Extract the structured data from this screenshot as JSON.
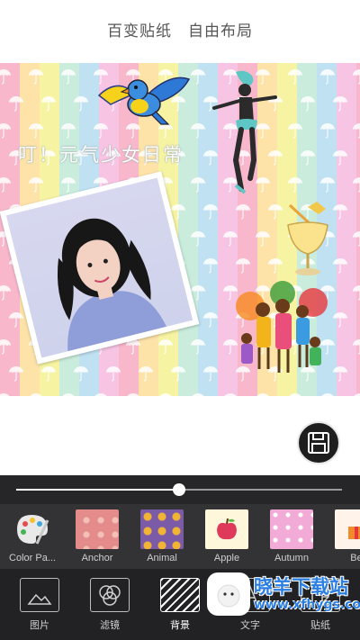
{
  "header": {
    "title": "百变贴纸　自由布局"
  },
  "canvas": {
    "caption": "叮！元气少女日常"
  },
  "slider": {
    "value": 0.5
  },
  "backgrounds": [
    {
      "label": "Color Pa...",
      "icon": "palette-icon",
      "color": "#333336"
    },
    {
      "label": "Anchor",
      "icon": "anchor-pattern",
      "color": "#e8888e"
    },
    {
      "label": "Animal",
      "icon": "animal-pattern",
      "color": "#7a5aa8"
    },
    {
      "label": "Apple",
      "icon": "apple-pattern",
      "color": "#fff7dc"
    },
    {
      "label": "Autumn",
      "icon": "autumn-pattern",
      "color": "#f3a9d6"
    },
    {
      "label": "Be",
      "icon": "pattern",
      "color": "#fff0e8"
    }
  ],
  "tabs": [
    {
      "label": "图片",
      "icon": "image-icon"
    },
    {
      "label": "滤镜",
      "icon": "filter-icon"
    },
    {
      "label": "背景",
      "icon": "background-icon",
      "active": true
    },
    {
      "label": "文字",
      "icon": "text-icon"
    },
    {
      "label": "贴纸",
      "icon": "sticker-icon"
    }
  ],
  "watermark": {
    "title": "晓羊下载站",
    "url": "www.xfhygs.com"
  }
}
